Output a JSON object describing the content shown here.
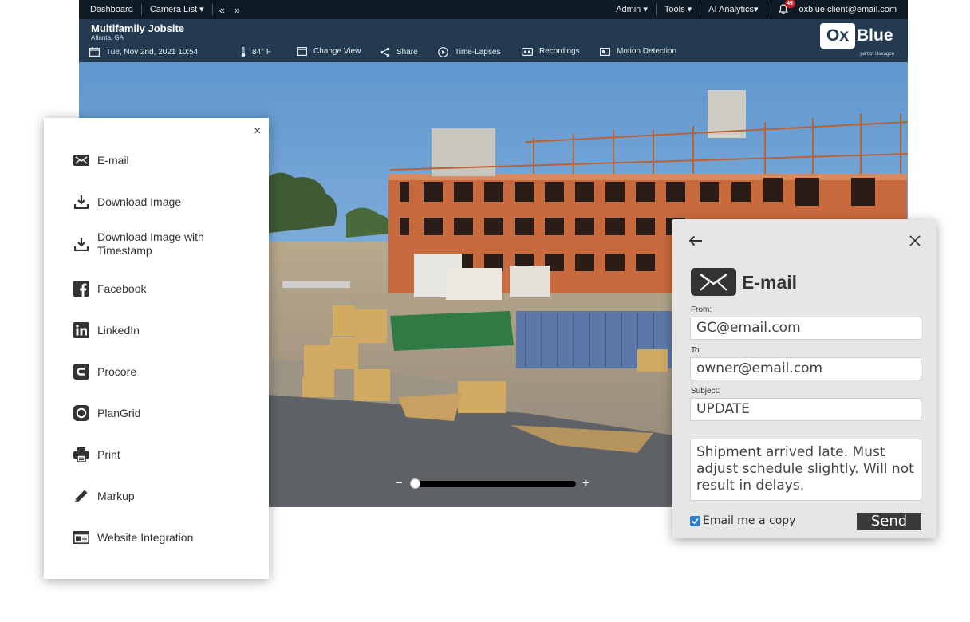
{
  "topbar": {
    "dashboard": "Dashboard",
    "camera_list": "Camera List ▾",
    "nav_arrows": "« »",
    "admin": "Admin ▾",
    "tools": "Tools ▾",
    "ai_analytics": "AI Analytics▾",
    "notification_count": "49",
    "user_email": "oxblue.client@email.com"
  },
  "header": {
    "site_title": "Multifamily Jobsite",
    "site_location": "Atlanta, GA",
    "datetime": "Tue, Nov 2nd, 2021 10:54",
    "temperature": "84° F",
    "change_view": "Change View",
    "share": "Share",
    "time_lapses": "Time-Lapses",
    "recordings": "Recordings",
    "motion_detection": "Motion Detection",
    "logo_ox": "Ox",
    "logo_blue": "Blue",
    "logo_sub": "part of Hexagon"
  },
  "zoom": {
    "minus": "−",
    "plus": "+",
    "level": 0.0
  },
  "share_menu": {
    "close": "×",
    "items": [
      {
        "label": "E-mail",
        "icon": "envelope-icon"
      },
      {
        "label": "Download Image",
        "icon": "download-icon"
      },
      {
        "label": "Download Image with Timestamp",
        "icon": "download-icon"
      },
      {
        "label": "Facebook",
        "icon": "facebook-icon"
      },
      {
        "label": "LinkedIn",
        "icon": "linkedin-icon"
      },
      {
        "label": "Procore",
        "icon": "procore-icon"
      },
      {
        "label": "PlanGrid",
        "icon": "plangrid-icon"
      },
      {
        "label": "Print",
        "icon": "printer-icon"
      },
      {
        "label": "Markup",
        "icon": "pencil-icon"
      },
      {
        "label": "Website Integration",
        "icon": "website-icon"
      }
    ]
  },
  "email_dialog": {
    "title": "E-mail",
    "from_label": "From:",
    "from_value": "GC@email.com",
    "to_label": "To:",
    "to_value": "owner@email.com",
    "subject_label": "Subject:",
    "subject_value": "UPDATE",
    "message": "Shipment arrived late. Must adjust schedule slightly. Will not result in delays.",
    "copy_label": "Email me a copy",
    "copy_checked": true,
    "send_label": "Send"
  }
}
